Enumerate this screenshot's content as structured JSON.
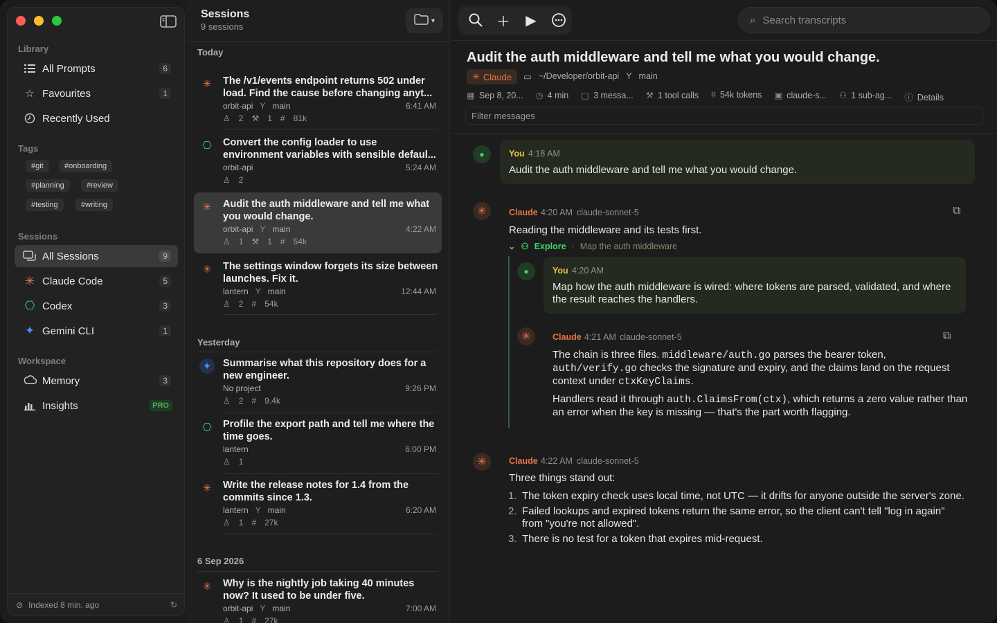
{
  "colors": {
    "accent_claude": "#e8734a",
    "accent_user": "#3dd66a",
    "pro": "#4caf50"
  },
  "sidebar": {
    "library_label": "Library",
    "library": [
      {
        "label": "All Prompts",
        "count": "6",
        "icon": "list-icon"
      },
      {
        "label": "Favourites",
        "count": "1",
        "icon": "star-icon"
      },
      {
        "label": "Recently Used",
        "count": "",
        "icon": "clock-icon"
      }
    ],
    "tags_label": "Tags",
    "tags": [
      "#git",
      "#onboarding",
      "#planning",
      "#review",
      "#testing",
      "#writing"
    ],
    "sessions_label": "Sessions",
    "sessions": [
      {
        "label": "All Sessions",
        "count": "9",
        "icon": "chat-icon"
      },
      {
        "label": "Claude Code",
        "count": "5",
        "icon": "claude-icon"
      },
      {
        "label": "Codex",
        "count": "3",
        "icon": "openai-icon"
      },
      {
        "label": "Gemini CLI",
        "count": "1",
        "icon": "gemini-icon"
      }
    ],
    "workspace_label": "Workspace",
    "workspace": [
      {
        "label": "Memory",
        "count": "3",
        "icon": "memory-icon"
      },
      {
        "label": "Insights",
        "badge": "PRO",
        "icon": "chart-icon"
      }
    ],
    "footer": "Indexed 8 min. ago"
  },
  "list": {
    "title": "Sessions",
    "subtitle": "9 sessions",
    "groups": [
      "Today",
      "Yesterday",
      "6 Sep 2026"
    ],
    "items": [
      {
        "title": "The /v1/events endpoint returns 502 under load. Find the cause before changing anyt...",
        "project": "orbit-api",
        "branch": "main",
        "time": "6:41 AM",
        "users": "2",
        "tools": "1",
        "tokens": "81k",
        "agent": "claude"
      },
      {
        "title": "Convert the config loader to use environment variables with sensible defaul...",
        "project": "orbit-api",
        "branch": "",
        "time": "5:24 AM",
        "users": "2",
        "tools": "",
        "tokens": "",
        "agent": "codex"
      },
      {
        "title": "Audit the auth middleware and tell me what you would change.",
        "project": "orbit-api",
        "branch": "main",
        "time": "4:22 AM",
        "users": "1",
        "tools": "1",
        "tokens": "54k",
        "agent": "claude"
      },
      {
        "title": "The settings window forgets its size between launches. Fix it.",
        "project": "lantern",
        "branch": "main",
        "time": "12:44 AM",
        "users": "2",
        "tools": "",
        "tokens": "54k",
        "agent": "claude"
      },
      {
        "title": "Summarise what this repository does for a new engineer.",
        "project": "No project",
        "branch": "",
        "time": "9:26 PM",
        "users": "2",
        "tools": "",
        "tokens": "9.4k",
        "agent": "gemini"
      },
      {
        "title": "Profile the export path and tell me where the time goes.",
        "project": "lantern",
        "branch": "",
        "time": "6:00 PM",
        "users": "1",
        "tools": "",
        "tokens": "",
        "agent": "codex"
      },
      {
        "title": "Write the release notes for 1.4 from the commits since 1.3.",
        "project": "lantern",
        "branch": "main",
        "time": "6:20 AM",
        "users": "1",
        "tools": "",
        "tokens": "27k",
        "agent": "claude"
      },
      {
        "title": "Why is the nightly job taking 40 minutes now? It used to be under five.",
        "project": "orbit-api",
        "branch": "main",
        "time": "7:00 AM",
        "users": "1",
        "tools": "",
        "tokens": "27k",
        "agent": "claude"
      }
    ]
  },
  "main": {
    "search_placeholder": "Search transcripts",
    "title": "Audit the auth middleware and tell me what you would change.",
    "agent_chip": "Claude",
    "project_path": "~/Developer/orbit-api",
    "branch": "main",
    "info": {
      "date": "Sep 8, 20...",
      "duration": "4 min",
      "messages": "3 messa...",
      "tools": "1 tool calls",
      "tokens": "54k tokens",
      "model": "claude-s...",
      "subagents": "1 sub-ag...",
      "details": "Details"
    },
    "filter_placeholder": "Filter messages",
    "m1": {
      "who": "You",
      "time": "4:18 AM",
      "text": "Audit the auth middleware and tell me what you would change."
    },
    "m2": {
      "who": "Claude",
      "time": "4:20 AM",
      "model": "claude-sonnet-5",
      "text": "Reading the middleware and its tests first.",
      "sub_label": "Explore",
      "sub_desc": "Map the auth middleware"
    },
    "m3": {
      "who": "You",
      "time": "4:20 AM",
      "text": "Map how the auth middleware is wired: where tokens are parsed, validated, and where the result reaches the handlers."
    },
    "m4": {
      "who": "Claude",
      "time": "4:21 AM",
      "model": "claude-sonnet-5",
      "p1a": "The chain is three files. ",
      "p1b": "middleware/auth.go",
      "p1c": " parses the bearer token, ",
      "p1d": "auth/verify.go",
      "p1e": " checks the signature and expiry, and the claims land on the request context under ",
      "p1f": "ctxKeyClaims",
      "p1g": ".",
      "p2a": "Handlers read it through ",
      "p2b": "auth.ClaimsFrom(ctx)",
      "p2c": ", which returns a zero value rather than an error when the key is missing — that's the part worth flagging."
    },
    "m5": {
      "who": "Claude",
      "time": "4:22 AM",
      "model": "claude-sonnet-5",
      "intro": "Three things stand out:",
      "points": [
        "The token expiry check uses local time, not UTC — it drifts for anyone outside the server's zone.",
        "Failed lookups and expired tokens return the same error, so the client can't tell \"log in again\" from \"you're not allowed\".",
        "There is no test for a token that expires mid-request."
      ]
    }
  }
}
